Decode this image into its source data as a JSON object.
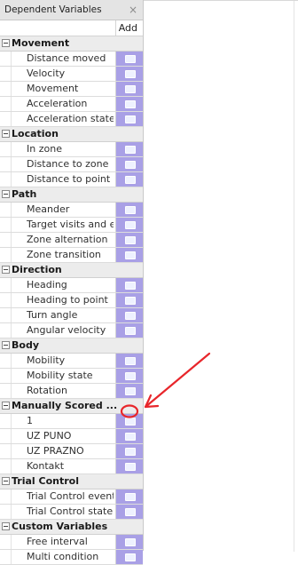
{
  "panel": {
    "title": "Dependent Variables",
    "close_glyph": "×",
    "add_header": "Add"
  },
  "categories": [
    {
      "name": "Movement",
      "items": [
        {
          "label": "Distance moved",
          "has_add": true
        },
        {
          "label": "Velocity",
          "has_add": true
        },
        {
          "label": "Movement",
          "has_add": true
        },
        {
          "label": "Acceleration",
          "has_add": true
        },
        {
          "label": "Acceleration state",
          "has_add": true
        }
      ]
    },
    {
      "name": "Location",
      "items": [
        {
          "label": "In zone",
          "has_add": true
        },
        {
          "label": "Distance to zone",
          "has_add": true
        },
        {
          "label": "Distance to point",
          "has_add": true
        }
      ]
    },
    {
      "name": "Path",
      "items": [
        {
          "label": "Meander",
          "has_add": true
        },
        {
          "label": "Target visits and e...",
          "has_add": true
        },
        {
          "label": "Zone alternation",
          "has_add": true
        },
        {
          "label": "Zone transition",
          "has_add": true
        }
      ]
    },
    {
      "name": "Direction",
      "items": [
        {
          "label": "Heading",
          "has_add": true
        },
        {
          "label": "Heading to point",
          "has_add": true
        },
        {
          "label": "Turn angle",
          "has_add": true
        },
        {
          "label": "Angular velocity",
          "has_add": true
        }
      ]
    },
    {
      "name": "Body",
      "items": [
        {
          "label": "Mobility",
          "has_add": true
        },
        {
          "label": "Mobility state",
          "has_add": true
        },
        {
          "label": "Rotation",
          "has_add": true
        }
      ]
    },
    {
      "name": "Manually Scored ...",
      "items": [
        {
          "label": "1",
          "has_add": true
        },
        {
          "label": "UZ PUNO",
          "has_add": true
        },
        {
          "label": "UZ PRAZNO",
          "has_add": true
        },
        {
          "label": "Kontakt",
          "has_add": true
        }
      ]
    },
    {
      "name": "Trial Control",
      "items": [
        {
          "label": "Trial Control event",
          "has_add": true
        },
        {
          "label": "Trial Control state",
          "has_add": true
        }
      ]
    },
    {
      "name": "Custom Variables",
      "items": [
        {
          "label": "Free interval",
          "has_add": true
        },
        {
          "label": "Multi condition",
          "has_add": true
        }
      ]
    }
  ],
  "colors": {
    "add_cell": "#a9a0e6",
    "annotation": "#e8262b"
  },
  "annotation": {
    "type": "red-arrow-and-circle",
    "target": "Manually Scored ... / 1 add button"
  }
}
